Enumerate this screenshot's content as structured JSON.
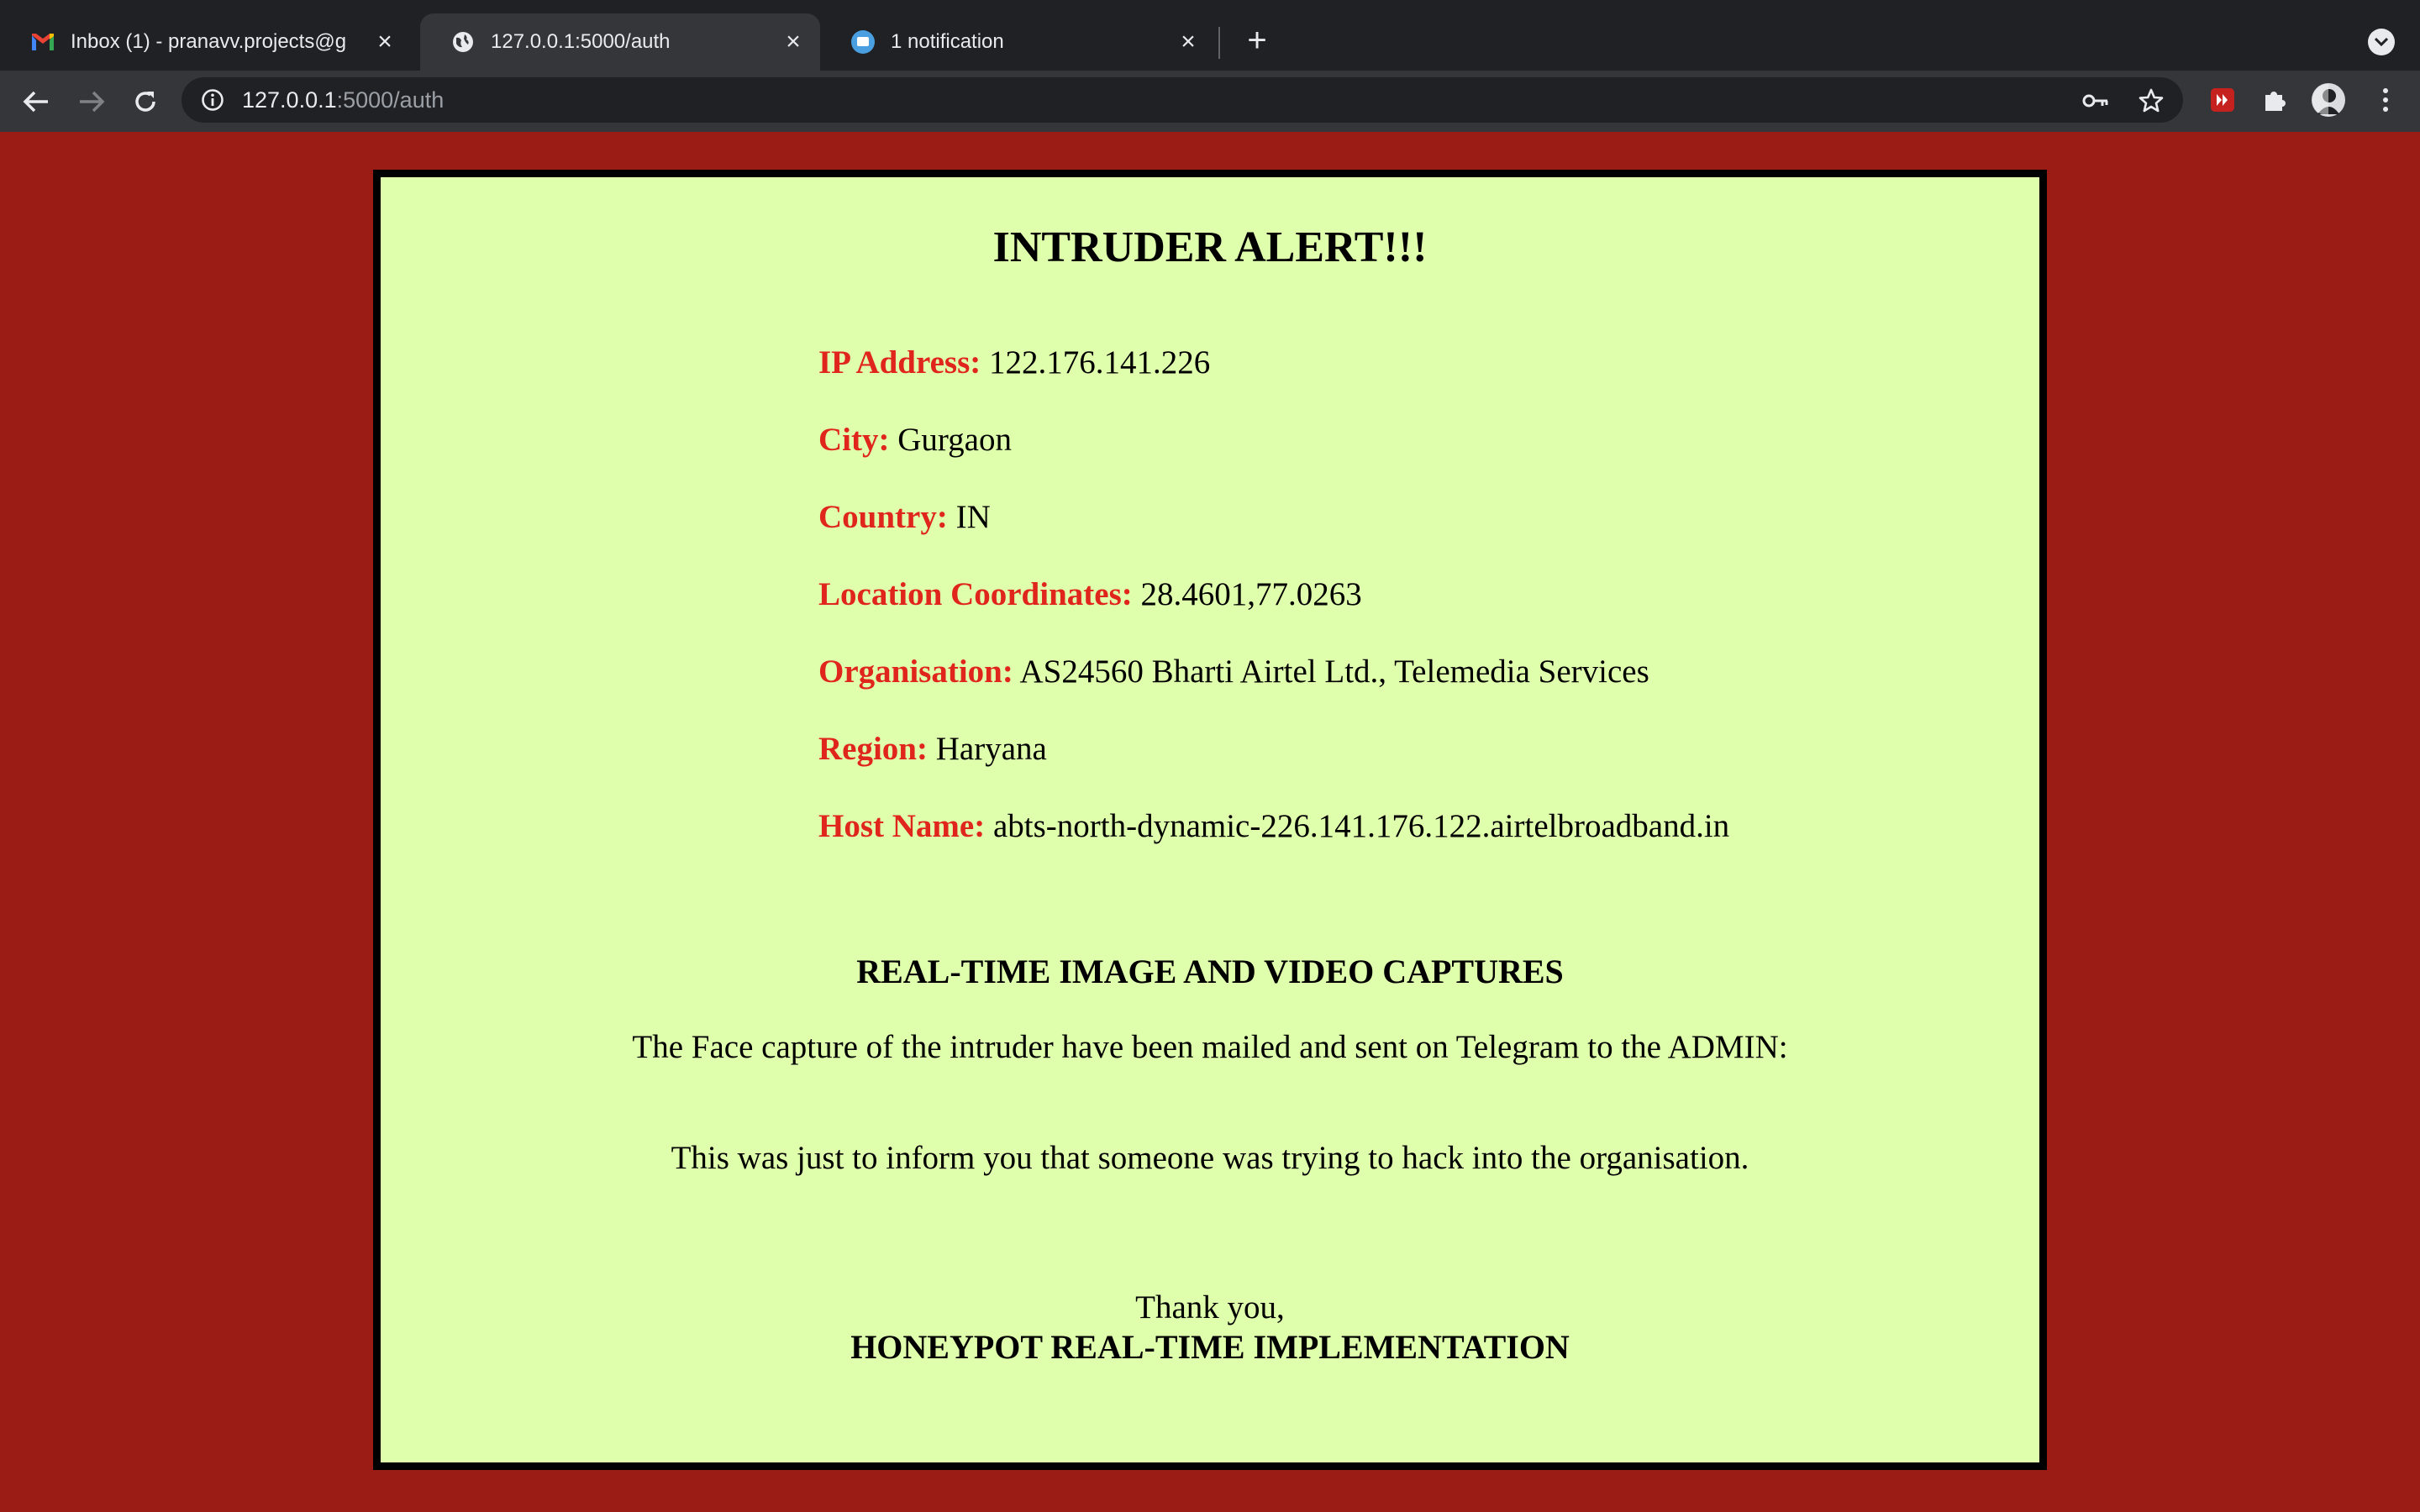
{
  "browser": {
    "tabs": [
      {
        "title": "Inbox (1) - pranavv.projects@g",
        "icon": "gmail-icon",
        "active": false
      },
      {
        "title": "127.0.0.1:5000/auth",
        "icon": "globe-icon",
        "active": true
      },
      {
        "title": "1 notification",
        "icon": "chat-icon",
        "active": false
      }
    ],
    "url_host": "127.0.0.1",
    "url_rest": ":5000/auth"
  },
  "page": {
    "title": "INTRUDER ALERT!!!",
    "fields": [
      {
        "label": "IP Address:",
        "value": "122.176.141.226"
      },
      {
        "label": "City:",
        "value": "Gurgaon"
      },
      {
        "label": "Country:",
        "value": "IN"
      },
      {
        "label": "Location Coordinates:",
        "value": "28.4601,77.0263"
      },
      {
        "label": "Organisation:",
        "value": "AS24560 Bharti Airtel Ltd., Telemedia Services"
      },
      {
        "label": "Region:",
        "value": "Haryana"
      },
      {
        "label": "Host Name:",
        "value": "abts-north-dynamic-226.141.176.122.airtelbroadband.in"
      }
    ],
    "captures_heading": "REAL-TIME IMAGE AND VIDEO CAPTURES",
    "captures_text": "The Face capture of the intruder have been mailed and sent on Telegram to the ADMIN:",
    "inform_text": "This was just to inform you that someone was trying to hack into the organisation.",
    "thanks": "Thank you,",
    "signature": "HONEYPOT REAL-TIME IMPLEMENTATION"
  },
  "colors": {
    "page_background": "#9b1c14",
    "card_background": "#e0ffad",
    "label_red": "#e0261c"
  }
}
